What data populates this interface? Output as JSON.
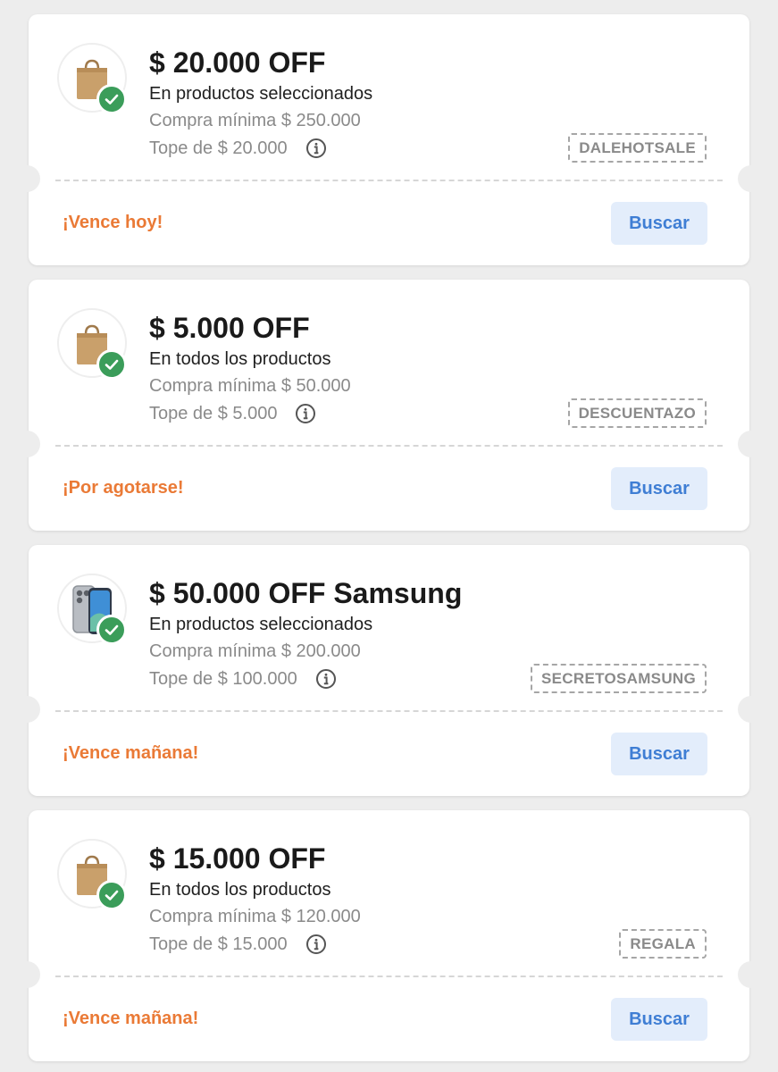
{
  "coupons": [
    {
      "title": "$ 20.000 OFF",
      "description": "En productos seleccionados",
      "min_purchase": "Compra mínima $ 250.000",
      "cap": "Tope de $ 20.000",
      "code": "DALEHOTSALE",
      "expiry": "¡Vence hoy!",
      "button_label": "Buscar",
      "image": "shopping-bag"
    },
    {
      "title": "$ 5.000 OFF",
      "description": "En todos los productos",
      "min_purchase": "Compra mínima $ 50.000",
      "cap": "Tope de $ 5.000",
      "code": "DESCUENTAZO",
      "expiry": "¡Por agotarse!",
      "button_label": "Buscar",
      "image": "shopping-bag"
    },
    {
      "title": "$ 50.000 OFF Samsung",
      "description": "En productos seleccionados",
      "min_purchase": "Compra mínima $ 200.000",
      "cap": "Tope de $ 100.000",
      "code": "SECRETOSAMSUNG",
      "expiry": "¡Vence mañana!",
      "button_label": "Buscar",
      "image": "smartphone"
    },
    {
      "title": "$ 15.000 OFF",
      "description": "En todos los productos",
      "min_purchase": "Compra mínima $ 120.000",
      "cap": "Tope de $ 15.000",
      "code": "REGALA",
      "expiry": "¡Vence mañana!",
      "button_label": "Buscar",
      "image": "shopping-bag"
    }
  ],
  "colors": {
    "background": "#ededed",
    "card": "#ffffff",
    "expiry": "#ea7a36",
    "button_bg": "#e3edfb",
    "button_text": "#3f7ed4",
    "check": "#3b9d5a"
  },
  "icons": {
    "check": "check-icon",
    "info": "info-icon",
    "bag": "shopping-bag-icon",
    "phone": "smartphone-icon"
  }
}
